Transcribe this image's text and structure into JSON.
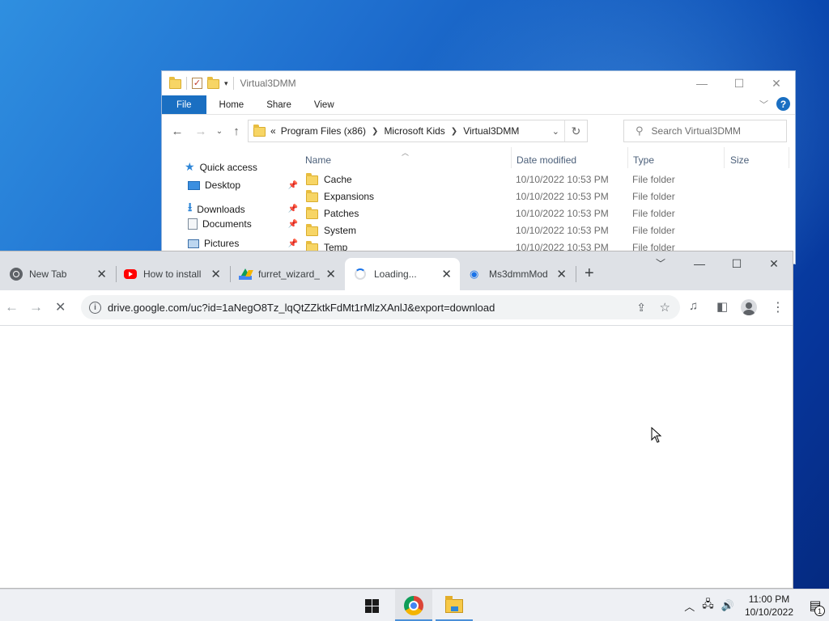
{
  "explorer": {
    "title": "Virtual3DMM",
    "ribbon_tabs": [
      "File",
      "Home",
      "Share",
      "View"
    ],
    "breadcrumb": [
      "Program Files (x86)",
      "Microsoft Kids",
      "Virtual3DMM"
    ],
    "breadcrumb_prefix": "«",
    "search_placeholder": "Search Virtual3DMM",
    "nav_items": [
      {
        "label": "Quick access",
        "icon": "star-icon"
      },
      {
        "label": "Desktop",
        "icon": "desktop-icon",
        "pinned": true
      },
      {
        "label": "Downloads",
        "icon": "download-icon",
        "pinned": true
      },
      {
        "label": "Documents",
        "icon": "documents-icon",
        "pinned": true
      },
      {
        "label": "Pictures",
        "icon": "pictures-icon",
        "pinned": true
      }
    ],
    "columns": {
      "name": "Name",
      "date": "Date modified",
      "type": "Type",
      "size": "Size"
    },
    "files": [
      {
        "name": "Cache",
        "date": "10/10/2022 10:53 PM",
        "type": "File folder"
      },
      {
        "name": "Expansions",
        "date": "10/10/2022 10:53 PM",
        "type": "File folder"
      },
      {
        "name": "Patches",
        "date": "10/10/2022 10:53 PM",
        "type": "File folder"
      },
      {
        "name": "System",
        "date": "10/10/2022 10:53 PM",
        "type": "File folder"
      },
      {
        "name": "Temp",
        "date": "10/10/2022 10:53 PM",
        "type": "File folder"
      }
    ],
    "accent": "#1a6fc2"
  },
  "browser": {
    "tabs": [
      {
        "title": "New Tab",
        "favicon": "chrome-icon"
      },
      {
        "title": "How to install",
        "favicon": "youtube-icon"
      },
      {
        "title": "furret_wizard_",
        "favicon": "google-drive-icon"
      },
      {
        "title": "Loading...",
        "favicon": "loading-spinner-icon",
        "active": true
      },
      {
        "title": "Ms3dmmMod",
        "favicon": "ms3dmm-icon"
      }
    ],
    "url": "drive.google.com/uc?id=1aNegO8Tz_lqQtZZktkFdMt1rMlzXAnlJ&export=download"
  },
  "taskbar": {
    "time": "11:00 PM",
    "date": "10/10/2022",
    "notification_count": "1"
  }
}
